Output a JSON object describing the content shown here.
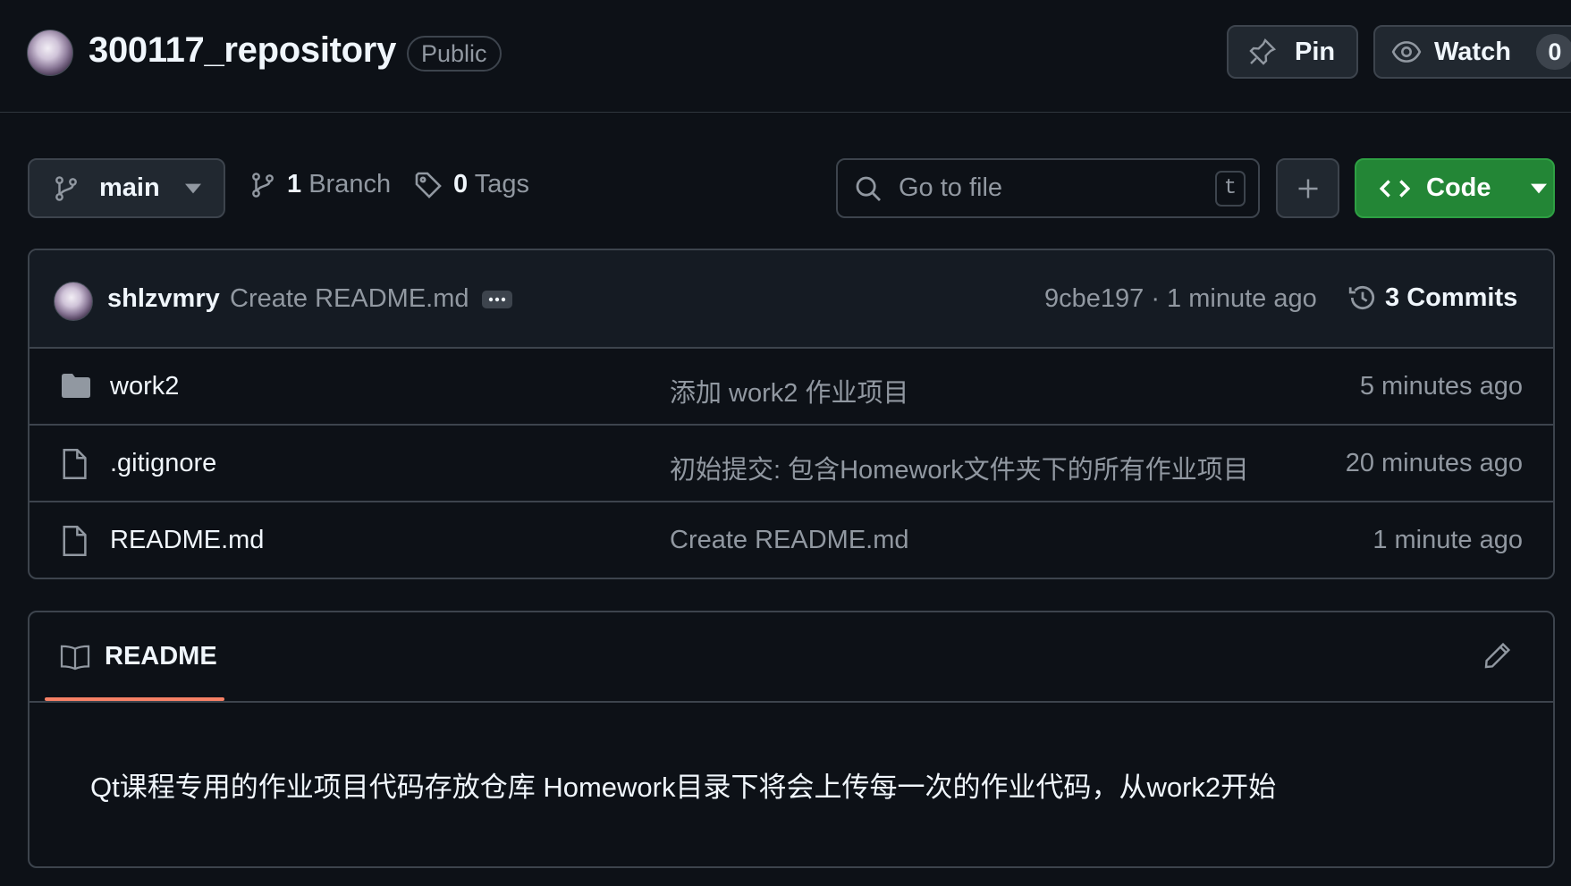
{
  "repo": {
    "name": "300117_repository",
    "visibility": "Public"
  },
  "header_actions": {
    "pin_label": "Pin",
    "watch_label": "Watch",
    "watch_count": "0"
  },
  "toolbar": {
    "branch": "main",
    "branch_count": "1",
    "branch_label": "Branch",
    "tag_count": "0",
    "tag_label": "Tags",
    "search_placeholder": "Go to file",
    "search_shortcut": "t",
    "code_label": "Code"
  },
  "latest_commit": {
    "author": "shlzvmry",
    "message": "Create README.md",
    "hash_time": "9cbe197 · 1 minute ago",
    "commits_count": "3",
    "commits_label": "Commits"
  },
  "files": [
    {
      "name": "work2",
      "icon": "folder-icon",
      "commit": "添加 work2 作业项目",
      "time": "5 minutes ago"
    },
    {
      "name": ".gitignore",
      "icon": "file-icon",
      "commit": "初始提交: 包含Homework文件夹下的所有作业项目",
      "time": "20 minutes ago"
    },
    {
      "name": "README.md",
      "icon": "file-icon",
      "commit": "Create README.md",
      "time": "1 minute ago"
    }
  ],
  "readme": {
    "tab_label": "README",
    "content": "Qt课程专用的作业项目代码存放仓库 Homework目录下将会上传每一次的作业代码，从work2开始"
  },
  "colors": {
    "background": "#0d1117",
    "border": "#3d444d",
    "accent_green": "#238636",
    "tab_underline": "#f78166"
  }
}
